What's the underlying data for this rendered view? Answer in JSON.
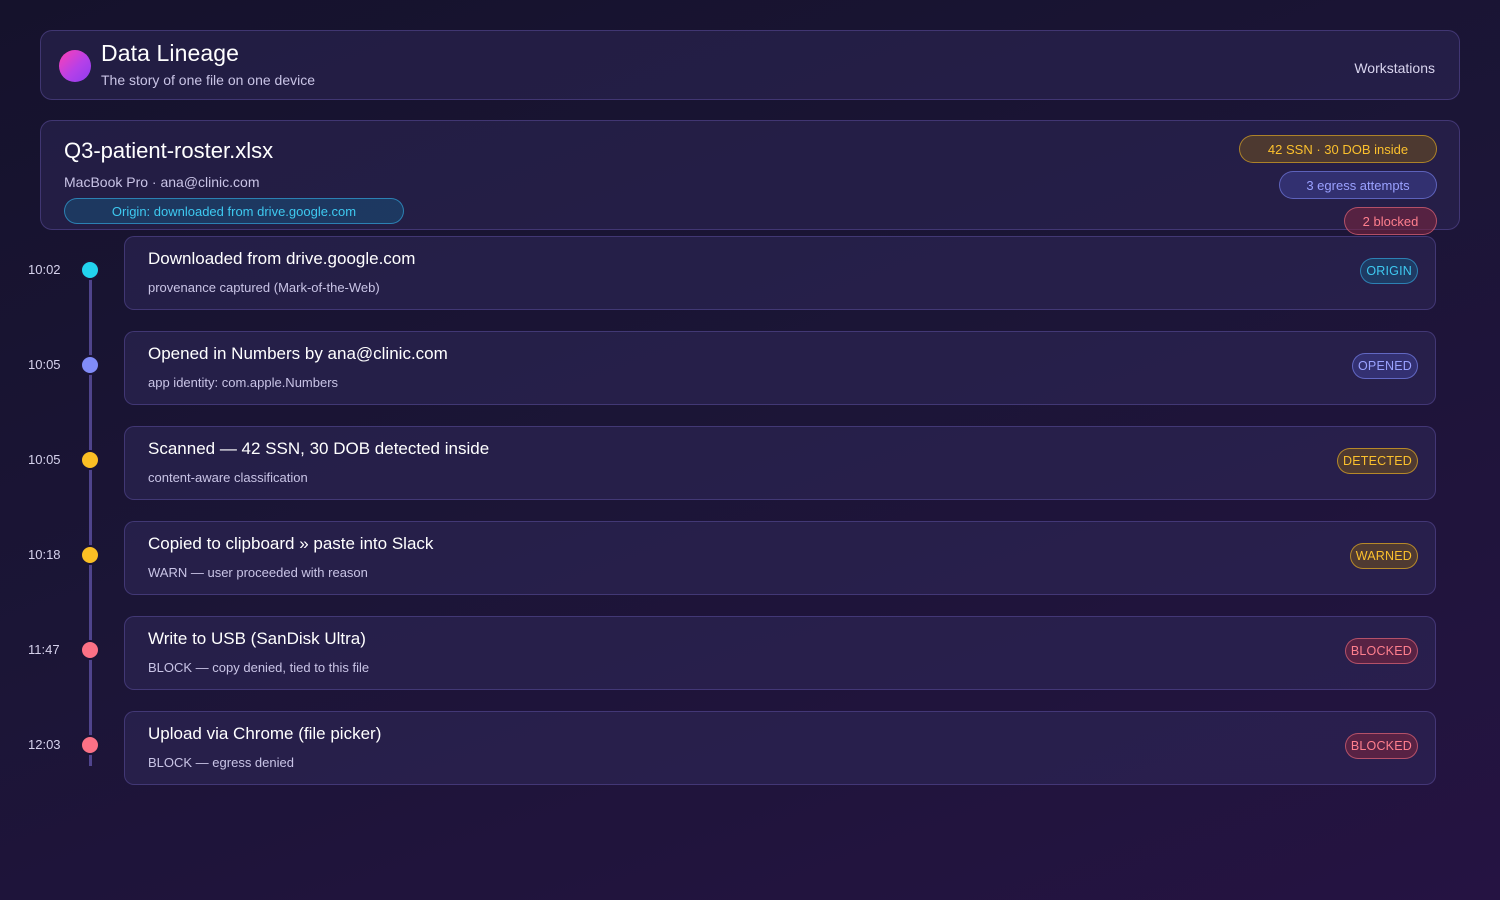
{
  "header": {
    "title": "Data Lineage",
    "subtitle": "The story of one file on one device",
    "nav_link": "Workstations"
  },
  "file": {
    "name": "Q3-patient-roster.xlsx",
    "meta": "MacBook Pro · ana@clinic.com",
    "origin": "Origin: downloaded from drive.google.com",
    "stats": {
      "sensitive": "42 SSN · 30 DOB inside",
      "egress": "3 egress attempts",
      "blocked": "2 blocked"
    }
  },
  "events": [
    {
      "time": "10:02",
      "title": "Downloaded from drive.google.com",
      "detail": "provenance captured (Mark-of-the-Web)",
      "badge": "ORIGIN",
      "status": "origin",
      "color": "#22d3ee"
    },
    {
      "time": "10:05",
      "title": "Opened in Numbers by ana@clinic.com",
      "detail": "app identity: com.apple.Numbers",
      "badge": "OPENED",
      "status": "opened",
      "color": "#818cf8"
    },
    {
      "time": "10:05",
      "title": "Scanned — 42 SSN, 30 DOB detected inside",
      "detail": "content-aware classification",
      "badge": "DETECTED",
      "status": "detected",
      "color": "#fbbf24"
    },
    {
      "time": "10:18",
      "title": "Copied to clipboard » paste into Slack",
      "detail": "WARN — user proceeded with reason",
      "badge": "WARNED",
      "status": "warned",
      "color": "#fbbf24"
    },
    {
      "time": "11:47",
      "title": "Write to USB (SanDisk Ultra)",
      "detail": "BLOCK — copy denied, tied to this file",
      "badge": "BLOCKED",
      "status": "blocked",
      "color": "#fb7185"
    },
    {
      "time": "12:03",
      "title": "Upload via Chrome (file picker)",
      "detail": "BLOCK — egress denied",
      "badge": "BLOCKED",
      "status": "blocked",
      "color": "#fb7185"
    }
  ]
}
